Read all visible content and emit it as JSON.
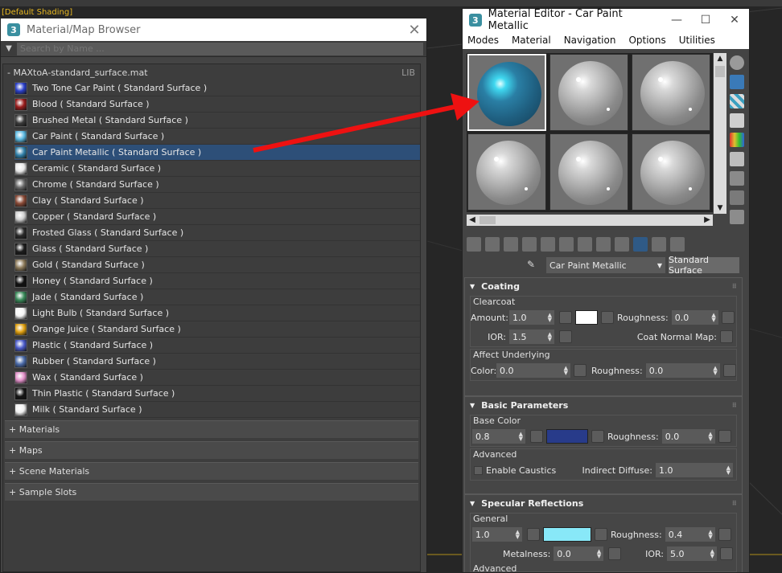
{
  "viewport": {
    "label": "[Default Shading]"
  },
  "browser": {
    "title": "Material/Map Browser",
    "search_placeholder": "Search by Name ...",
    "library": {
      "name": "- MAXtoA-standard_surface.mat",
      "tag": "LIB"
    },
    "materials": [
      {
        "label": "Two Tone Car Paint  ( Standard Surface )",
        "swatch": "#2a3fc8"
      },
      {
        "label": "Blood  ( Standard Surface )",
        "swatch": "#9a1c1c"
      },
      {
        "label": "Brushed Metal  ( Standard Surface )",
        "swatch": "#3a3a3a"
      },
      {
        "label": "Car Paint  ( Standard Surface )",
        "swatch": "#5bb8e0"
      },
      {
        "label": "Car Paint Metallic  ( Standard Surface )",
        "swatch": "#2f7fa8"
      },
      {
        "label": "Ceramic  ( Standard Surface )",
        "swatch": "#e6e6e6"
      },
      {
        "label": "Chrome  ( Standard Surface )",
        "swatch": "#6a6a6a"
      },
      {
        "label": "Clay  ( Standard Surface )",
        "swatch": "#8a4a36"
      },
      {
        "label": "Copper  ( Standard Surface )",
        "swatch": "#cfcfcf"
      },
      {
        "label": "Frosted Glass  ( Standard Surface )",
        "swatch": "#2a2a2a"
      },
      {
        "label": "Glass  ( Standard Surface )",
        "swatch": "#1c1c1c"
      },
      {
        "label": "Gold  ( Standard Surface )",
        "swatch": "#8c7a5a"
      },
      {
        "label": "Honey  ( Standard Surface )",
        "swatch": "#111111"
      },
      {
        "label": "Jade  ( Standard Surface )",
        "swatch": "#3a8a5a"
      },
      {
        "label": "Light Bulb  ( Standard Surface )",
        "swatch": "#f4f4f4"
      },
      {
        "label": "Orange Juice  ( Standard Surface )",
        "swatch": "#e0a010"
      },
      {
        "label": "Plastic  ( Standard Surface )",
        "swatch": "#4a5ac8"
      },
      {
        "label": "Rubber  ( Standard Surface )",
        "swatch": "#4a6aa8"
      },
      {
        "label": "Wax  ( Standard Surface )",
        "swatch": "#e090c8"
      },
      {
        "label": "Thin Plastic  ( Standard Surface )",
        "swatch": "#151515"
      },
      {
        "label": "Milk  ( Standard Surface )",
        "swatch": "#efefef"
      }
    ],
    "categories": [
      "+ Materials",
      "+ Maps",
      "+ Scene Materials",
      "+ Sample Slots"
    ]
  },
  "editor": {
    "title": "Material Editor - Car Paint Metallic",
    "menu": [
      "Modes",
      "Material",
      "Navigation",
      "Options",
      "Utilities"
    ],
    "material_name": "Car Paint Metallic",
    "material_type": "Standard Surface",
    "coating": {
      "title": "Coating",
      "clearcoat_group": "Clearcoat",
      "amount_label": "Amount:",
      "amount": "1.0",
      "roughness_label": "Roughness:",
      "roughness": "0.0",
      "ior_label": "IOR:",
      "ior": "1.5",
      "coat_normal_label": "Coat Normal Map:",
      "affect_group": "Affect Underlying",
      "color_label": "Color:",
      "color": "0.0",
      "aff_roughness_label": "Roughness:",
      "aff_roughness": "0.0"
    },
    "basic": {
      "title": "Basic Parameters",
      "base_color_group": "Base Color",
      "base_weight": "0.8",
      "base_color": "#283b8a",
      "roughness_label": "Roughness:",
      "roughness": "0.0",
      "advanced_group": "Advanced",
      "caustics_label": "Enable Caustics",
      "indirect_label": "Indirect Diffuse:",
      "indirect": "1.0"
    },
    "specular": {
      "title": "Specular Reflections",
      "general_group": "General",
      "weight": "1.0",
      "color": "#88e8f8",
      "roughness_label": "Roughness:",
      "roughness": "0.4",
      "metalness_label": "Metalness:",
      "metalness": "0.0",
      "ior_label": "IOR:",
      "ior": "5.0",
      "advanced_partial": "Advanced"
    }
  }
}
